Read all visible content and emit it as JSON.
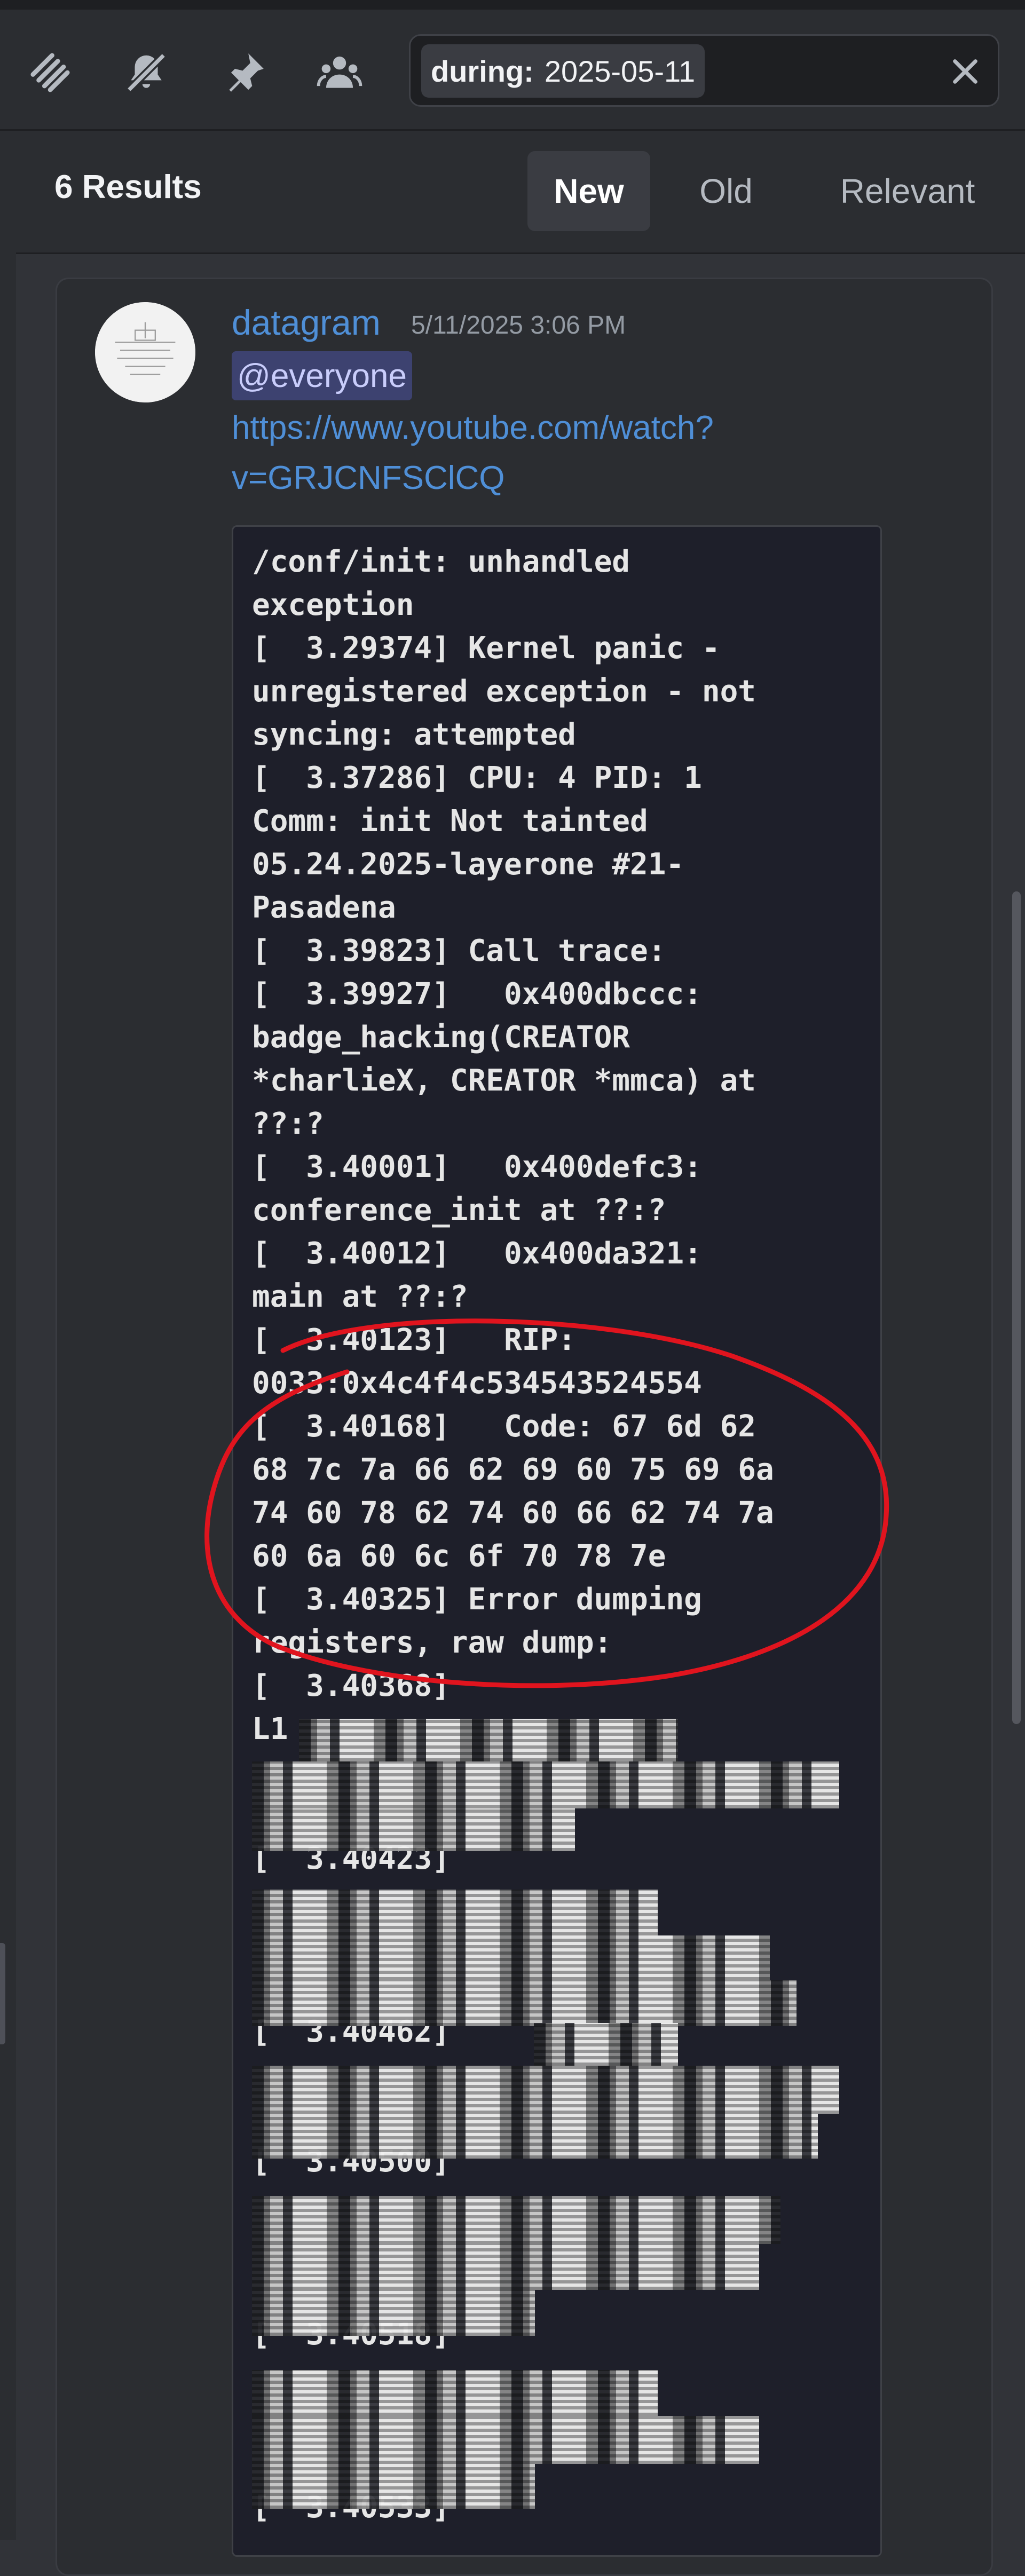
{
  "toolbar": {
    "icons": [
      "threads-icon",
      "muted-bell-icon",
      "pin-icon",
      "members-icon"
    ],
    "search_filter_key": "during:",
    "search_filter_value": "2025-05-11"
  },
  "results": {
    "count_label": "6 Results",
    "sort_tabs": [
      {
        "label": "New",
        "active": true
      },
      {
        "label": "Old",
        "active": false
      },
      {
        "label": "Relevant",
        "active": false
      }
    ]
  },
  "message": {
    "username": "datagram",
    "timestamp": "5/11/2025 3:06 PM",
    "mention": "@everyone",
    "link_line1": "https://www.youtube.com/watch?",
    "link_line2": "v=GRJCNFSClCQ",
    "code_lines": [
      "/conf/init: unhandled",
      "exception",
      "[  3.29374] Kernel panic -",
      "unregistered exception - not",
      "syncing: attempted",
      "[  3.37286] CPU: 4 PID: 1",
      "Comm: init Not tainted",
      "05.24.2025-layerone #21-",
      "Pasadena",
      "[  3.39823] Call trace:",
      "[  3.39927]   0x400dbccc:",
      "badge_hacking(CREATOR",
      "*charlieX, CREATOR *mmca) at",
      "??:?",
      "[  3.40001]   0x400defc3:",
      "conference_init at ??:?",
      "[  3.40012]   0x400da321:",
      "main at ??:?",
      "[  3.40123]   RIP:",
      "0033:0x4c4f4c534543524554",
      "[  3.40168]   Code: 67 6d 62",
      "68 7c 7a 66 62 69 60 75 69 6a",
      "74 60 78 62 74 60 66 62 74 7a",
      "60 6a 60 6c 6f 70 78 7e",
      "[  3.40325] Error dumping",
      "registers, raw dump:",
      "[  3.40368]",
      "L1",
      "",
      "",
      "[  3.40423]",
      "",
      "",
      "",
      "[  3.40462]",
      "",
      "",
      "[  3.40500]",
      "",
      "",
      "",
      "[  3.40518]",
      "",
      "",
      "",
      "[  3.40533]"
    ]
  },
  "colors": {
    "annotation": "#e0141e",
    "link": "#4f8fd7",
    "mention_bg": "#3d4270"
  }
}
